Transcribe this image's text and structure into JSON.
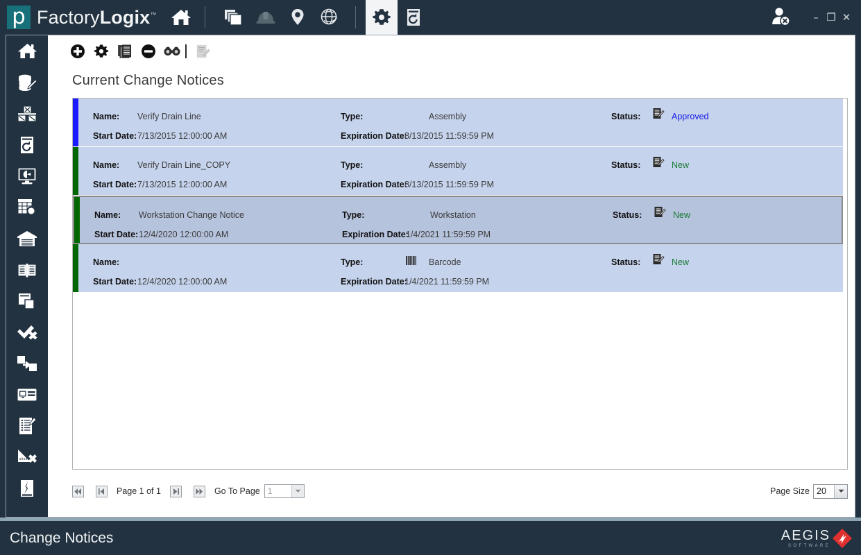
{
  "titlebar": {
    "logo_letter": "p",
    "brand_first": "Factory",
    "brand_second": "Logix",
    "brand_tm": "™",
    "home_icon": "home-icon",
    "nav_icons": [
      {
        "name": "copy-stack-icon",
        "active": false
      },
      {
        "name": "hardhat-icon",
        "active": false
      },
      {
        "name": "map-pin-icon",
        "active": false
      },
      {
        "name": "globe-icon",
        "active": false
      },
      {
        "name": "gear-icon",
        "active": true
      },
      {
        "name": "restore-history-icon",
        "active": false
      }
    ],
    "user_icon": "user-remove-icon",
    "window_controls": {
      "minimize": "–",
      "maximize": "❐",
      "close": "✕"
    }
  },
  "sidebar": {
    "items": [
      {
        "name": "sidebar-item-home",
        "icon": "home-icon"
      },
      {
        "name": "sidebar-item-database-edit",
        "icon": "database-edit-icon"
      },
      {
        "name": "sidebar-item-bom",
        "icon": "bom-blocks-icon"
      },
      {
        "name": "sidebar-item-revision-history",
        "icon": "revision-history-icon"
      },
      {
        "name": "sidebar-item-dashboard",
        "icon": "monitor-chart-icon"
      },
      {
        "name": "sidebar-item-data-search",
        "icon": "table-search-icon"
      },
      {
        "name": "sidebar-item-warehouse",
        "icon": "warehouse-icon"
      },
      {
        "name": "sidebar-item-documentation",
        "icon": "open-book-icon"
      },
      {
        "name": "sidebar-item-copy-document",
        "icon": "document-copy-icon"
      },
      {
        "name": "sidebar-item-approve-reject",
        "icon": "check-x-icon"
      },
      {
        "name": "sidebar-item-transfer",
        "icon": "transfer-arrow-icon"
      },
      {
        "name": "sidebar-item-label-card",
        "icon": "id-card-icon"
      },
      {
        "name": "sidebar-item-checklist-edit",
        "icon": "checklist-edit-icon"
      },
      {
        "name": "sidebar-item-measure-remove",
        "icon": "ruler-x-icon"
      },
      {
        "name": "sidebar-item-defect",
        "icon": "torn-document-icon"
      }
    ]
  },
  "content_toolbar": {
    "buttons": [
      {
        "name": "add-button",
        "icon": "plus-circle-icon",
        "enabled": true
      },
      {
        "name": "settings-button",
        "icon": "gear-icon",
        "enabled": true
      },
      {
        "name": "copy-button",
        "icon": "copy-documents-icon",
        "enabled": true
      },
      {
        "name": "delete-button",
        "icon": "minus-circle-icon",
        "enabled": true
      },
      {
        "name": "view-button",
        "icon": "binoculars-icon",
        "enabled": true
      },
      {
        "name": "edit-report-button",
        "icon": "document-edit-icon",
        "enabled": false
      }
    ]
  },
  "page": {
    "title": "Current Change Notices"
  },
  "grid": {
    "labels": {
      "name": "Name:",
      "start_date": "Start Date:",
      "type": "Type:",
      "expiration_date": "Expiration Date:",
      "status": "Status:"
    },
    "rows": [
      {
        "name": "Verify Drain Line",
        "start_date": "7/13/2015 12:00:00 AM",
        "type": "Assembly",
        "type_icon": null,
        "expiration_date": "8/13/2015 11:59:59 PM",
        "status": "Approved",
        "status_icon": "change-notice-icon",
        "status_color": "#1818e8",
        "bar_color": "#1a1aff",
        "selected": false
      },
      {
        "name": "Verify Drain Line_COPY",
        "start_date": "7/13/2015 12:00:00 AM",
        "type": "Assembly",
        "type_icon": null,
        "expiration_date": "8/13/2015 11:59:59 PM",
        "status": "New",
        "status_icon": "change-notice-icon",
        "status_color": "#1a7a35",
        "bar_color": "#006600",
        "selected": false
      },
      {
        "name": "Workstation Change Notice",
        "start_date": "12/4/2020 12:00:00 AM",
        "type": "Workstation",
        "type_icon": null,
        "expiration_date": "1/4/2021 11:59:59 PM",
        "status": "New",
        "status_icon": "change-notice-icon",
        "status_color": "#1a7a35",
        "bar_color": "#006600",
        "selected": true
      },
      {
        "name": "",
        "start_date": "12/4/2020 12:00:00 AM",
        "type": "Barcode",
        "type_icon": "barcode-icon",
        "expiration_date": "1/4/2021 11:59:59 PM",
        "status": "New",
        "status_icon": "change-notice-icon",
        "status_color": "#1a7a35",
        "bar_color": "#006600",
        "selected": false
      }
    ]
  },
  "pager": {
    "first_label": "⏮",
    "prev_label": "◀",
    "page_text": "Page 1 of 1",
    "next_label": "▶",
    "last_label": "⏭",
    "goto_label": "Go To Page",
    "goto_value": "1",
    "page_size_label": "Page Size",
    "page_size_value": "20"
  },
  "statusbar": {
    "title": "Change Notices",
    "logo_main": "AEGIS",
    "logo_sub": "SOFTWARE"
  },
  "colors": {
    "chrome": "#223240",
    "row": "#c5d3ec",
    "row_selected": "#b6c3dd",
    "accent_teal": "#17707a",
    "aegis_red": "#e03030"
  }
}
